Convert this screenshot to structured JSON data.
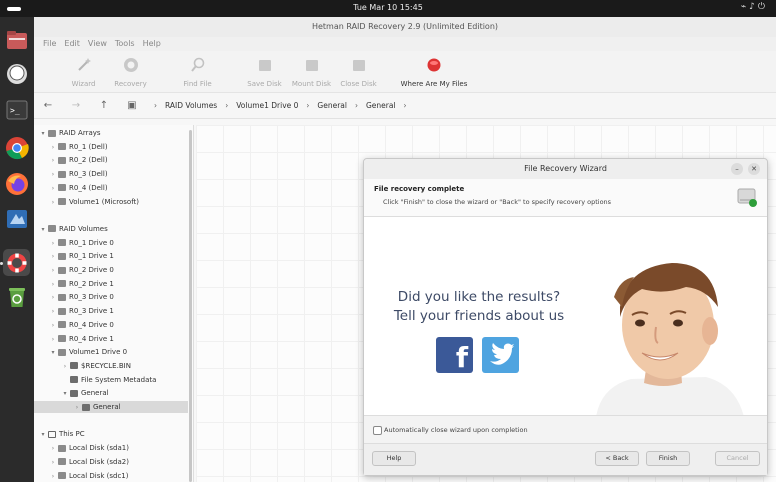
{
  "system": {
    "clock": "Tue Mar 10  15:45"
  },
  "dock": {
    "items": [
      {
        "name": "files-icon"
      },
      {
        "name": "chat-icon"
      },
      {
        "name": "terminal-icon"
      },
      {
        "name": "chrome-icon"
      },
      {
        "name": "firefox-icon"
      },
      {
        "name": "software-icon"
      },
      {
        "name": "lifebuoy-icon"
      },
      {
        "name": "recycle-icon"
      }
    ]
  },
  "window": {
    "title": "Hetman RAID Recovery 2.9 (Unlimited Edition)"
  },
  "menu": [
    "File",
    "Edit",
    "View",
    "Tools",
    "Help"
  ],
  "toolbar": {
    "wizard": "Wizard",
    "recovery": "Recovery",
    "find_file": "Find File",
    "save_disk": "Save Disk",
    "mount_disk": "Mount Disk",
    "close_disk": "Close Disk",
    "where_files": "Where Are My Files"
  },
  "breadcrumb": [
    "RAID Volumes",
    "Volume1 Drive 0",
    "General",
    "General"
  ],
  "tree": [
    {
      "label": "RAID Arrays",
      "level": 0,
      "exp": "v",
      "icon": "disk"
    },
    {
      "label": "R0_1 (Dell)",
      "level": 1,
      "exp": ">",
      "icon": "disk"
    },
    {
      "label": "R0_2 (Dell)",
      "level": 1,
      "exp": ">",
      "icon": "disk"
    },
    {
      "label": "R0_3 (Dell)",
      "level": 1,
      "exp": ">",
      "icon": "disk"
    },
    {
      "label": "R0_4 (Dell)",
      "level": 1,
      "exp": ">",
      "icon": "disk"
    },
    {
      "label": "Volume1 (Microsoft)",
      "level": 1,
      "exp": ">",
      "icon": "disk"
    },
    {
      "label": "",
      "level": 0,
      "exp": "",
      "icon": ""
    },
    {
      "label": "RAID Volumes",
      "level": 0,
      "exp": "v",
      "icon": "disk"
    },
    {
      "label": "R0_1 Drive 0",
      "level": 1,
      "exp": ">",
      "icon": "disk"
    },
    {
      "label": "R0_1 Drive 1",
      "level": 1,
      "exp": ">",
      "icon": "disk"
    },
    {
      "label": "R0_2 Drive 0",
      "level": 1,
      "exp": ">",
      "icon": "disk"
    },
    {
      "label": "R0_2 Drive 1",
      "level": 1,
      "exp": ">",
      "icon": "disk"
    },
    {
      "label": "R0_3 Drive 0",
      "level": 1,
      "exp": ">",
      "icon": "disk"
    },
    {
      "label": "R0_3 Drive 1",
      "level": 1,
      "exp": ">",
      "icon": "disk"
    },
    {
      "label": "R0_4 Drive 0",
      "level": 1,
      "exp": ">",
      "icon": "disk"
    },
    {
      "label": "R0_4 Drive 1",
      "level": 1,
      "exp": ">",
      "icon": "disk"
    },
    {
      "label": "Volume1 Drive 0",
      "level": 1,
      "exp": "v",
      "icon": "disk"
    },
    {
      "label": "$RECYCLE.BIN",
      "level": 2,
      "exp": ">",
      "icon": "folder"
    },
    {
      "label": "File System Metadata",
      "level": 2,
      "exp": "",
      "icon": "folder"
    },
    {
      "label": "General",
      "level": 2,
      "exp": "v",
      "icon": "folder"
    },
    {
      "label": "General",
      "level": 3,
      "exp": ">",
      "icon": "folder",
      "selected": true
    },
    {
      "label": "",
      "level": 0,
      "exp": "",
      "icon": ""
    },
    {
      "label": "This PC",
      "level": 0,
      "exp": "v",
      "icon": "pc"
    },
    {
      "label": "Local Disk (sda1)",
      "level": 1,
      "exp": ">",
      "icon": "disk"
    },
    {
      "label": "Local Disk (sda2)",
      "level": 1,
      "exp": ">",
      "icon": "disk"
    },
    {
      "label": "Local Disk (sdc1)",
      "level": 1,
      "exp": ">",
      "icon": "disk"
    }
  ],
  "dialog": {
    "title": "File Recovery Wizard",
    "heading": "File recovery complete",
    "subheading": "Click \"Finish\" to close the wizard or \"Back\" to specify recovery options",
    "promo_line1": "Did you like the results?",
    "promo_line2": "Tell your friends about us",
    "fb_letter": "f",
    "auto_close_label": "Automatically close wizard upon completion",
    "help": "Help",
    "back": "< Back",
    "finish": "Finish",
    "cancel": "Cancel"
  },
  "colors": {
    "facebook": "#3b5998",
    "twitter": "#4fa4e0",
    "promo_text": "#3d4a66"
  }
}
